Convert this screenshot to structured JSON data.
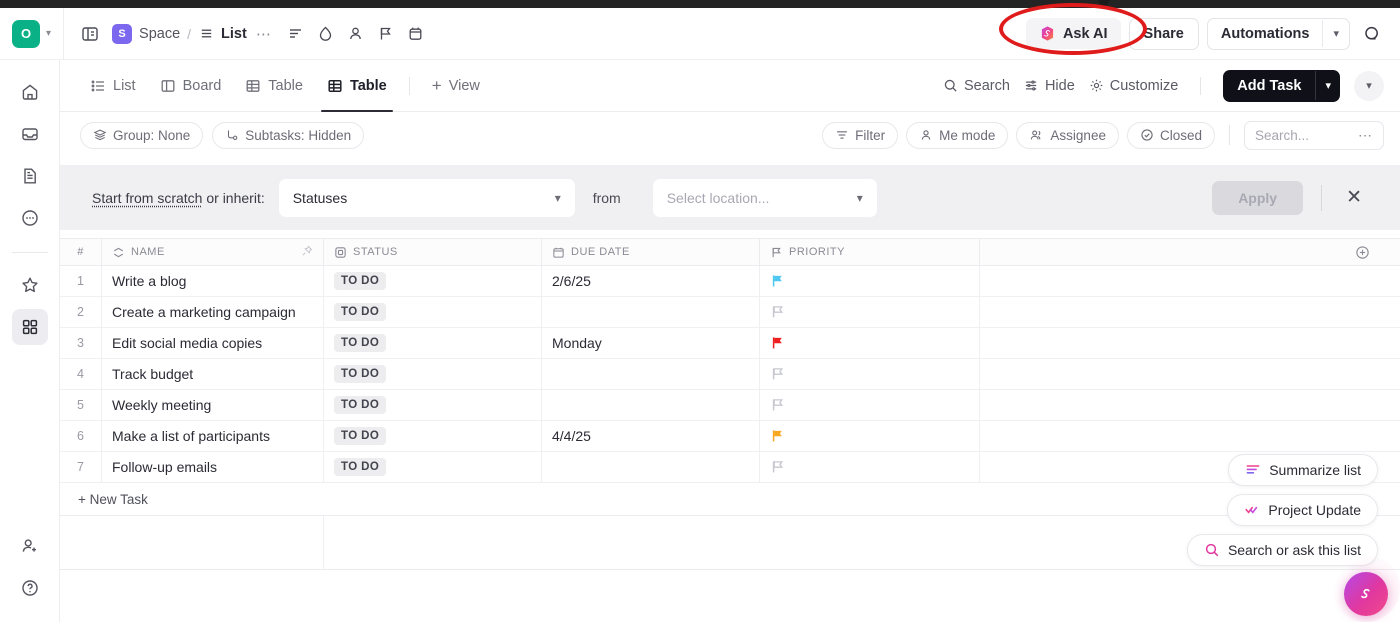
{
  "header": {
    "workspace_initial": "O",
    "space_badge": "S",
    "space_name": "Space",
    "separator": "/",
    "list_name": "List",
    "more_dots": "⋯",
    "ask_ai_label": "Ask AI",
    "share_label": "Share",
    "automations_label": "Automations",
    "icons": [
      "panel-toggle-icon",
      "list-lines-icon",
      "droplet-icon",
      "person-icon",
      "flag-icon",
      "calendar-icon",
      "search-icon"
    ]
  },
  "sidebar": {
    "items": [
      {
        "name": "home",
        "icon": "home-icon",
        "active": false
      },
      {
        "name": "inbox",
        "icon": "inbox-icon",
        "active": false
      },
      {
        "name": "docs",
        "icon": "document-icon",
        "active": false
      },
      {
        "name": "more",
        "icon": "more-circle-icon",
        "active": false
      },
      {
        "name": "favorites",
        "icon": "star-icon",
        "active": false
      },
      {
        "name": "dashboards",
        "icon": "grid-icon",
        "active": true
      }
    ],
    "bottom": [
      {
        "name": "invite",
        "icon": "user-plus-icon"
      },
      {
        "name": "help",
        "icon": "help-circle-icon"
      }
    ]
  },
  "view_tabs": {
    "tabs": [
      {
        "label": "List",
        "icon": "list-icon",
        "active": false
      },
      {
        "label": "Board",
        "icon": "board-icon",
        "active": false
      },
      {
        "label": "Table",
        "icon": "table-icon",
        "active": false
      },
      {
        "label": "Table",
        "icon": "table-icon",
        "active": true
      }
    ],
    "add_view_label": "View",
    "add_view_plus": "+",
    "search_label": "Search",
    "hide_label": "Hide",
    "customize_label": "Customize",
    "add_task_label": "Add Task"
  },
  "filter_bar": {
    "group_label": "Group: None",
    "subtasks_label": "Subtasks: Hidden",
    "filter_label": "Filter",
    "me_mode_label": "Me mode",
    "assignee_label": "Assignee",
    "closed_label": "Closed",
    "search_placeholder": "Search...",
    "more_dots": "⋯"
  },
  "banner": {
    "start_from_scratch": "Start from scratch",
    "or_inherit": " or inherit:",
    "inherit_value": "Statuses",
    "from_label": "from",
    "location_placeholder": "Select location...",
    "apply_label": "Apply",
    "close_label": "✕"
  },
  "table": {
    "columns": [
      {
        "key": "num",
        "label": "#",
        "icon": null
      },
      {
        "key": "name",
        "label": "NAME",
        "icon": "sort-icon"
      },
      {
        "key": "status",
        "label": "STATUS",
        "icon": "status-square-icon"
      },
      {
        "key": "due",
        "label": "DUE DATE",
        "icon": "calendar-icon"
      },
      {
        "key": "priority",
        "label": "PRIORITY",
        "icon": "flag-icon"
      }
    ],
    "add_column_icon": "plus-circle-icon",
    "rows": [
      {
        "num": "1",
        "name": "Write a blog",
        "status": "TO DO",
        "due": "2/6/25",
        "priority_color": "#4ec8f0"
      },
      {
        "num": "2",
        "name": "Create a marketing campaign",
        "status": "TO DO",
        "due": "",
        "priority_color": "#c7c7d0"
      },
      {
        "num": "3",
        "name": "Edit social media copies",
        "status": "TO DO",
        "due": "Monday",
        "priority_color": "#f01f1f"
      },
      {
        "num": "4",
        "name": "Track budget",
        "status": "TO DO",
        "due": "",
        "priority_color": "#c7c7d0"
      },
      {
        "num": "5",
        "name": "Weekly meeting",
        "status": "TO DO",
        "due": "",
        "priority_color": "#c7c7d0"
      },
      {
        "num": "6",
        "name": "Make a list of participants",
        "status": "TO DO",
        "due": "4/4/25",
        "priority_color": "#f5a820"
      },
      {
        "num": "7",
        "name": "Follow-up emails",
        "status": "TO DO",
        "due": "",
        "priority_color": "#c7c7d0"
      }
    ],
    "new_task_label": "+ New Task"
  },
  "ai_panel": {
    "summarize_label": "Summarize list",
    "project_update_label": "Project Update",
    "search_ask_label": "Search or ask this list",
    "fab_icon": "clickup-ai-icon"
  },
  "annotation": {
    "shape": "ellipse",
    "color": "#e01b1b",
    "target": "Ask AI"
  },
  "colors": {
    "brand_green": "#0ab187",
    "space_purple": "#7b68ee",
    "accent_dark": "#101018",
    "annotation_red": "#e01b1b"
  }
}
